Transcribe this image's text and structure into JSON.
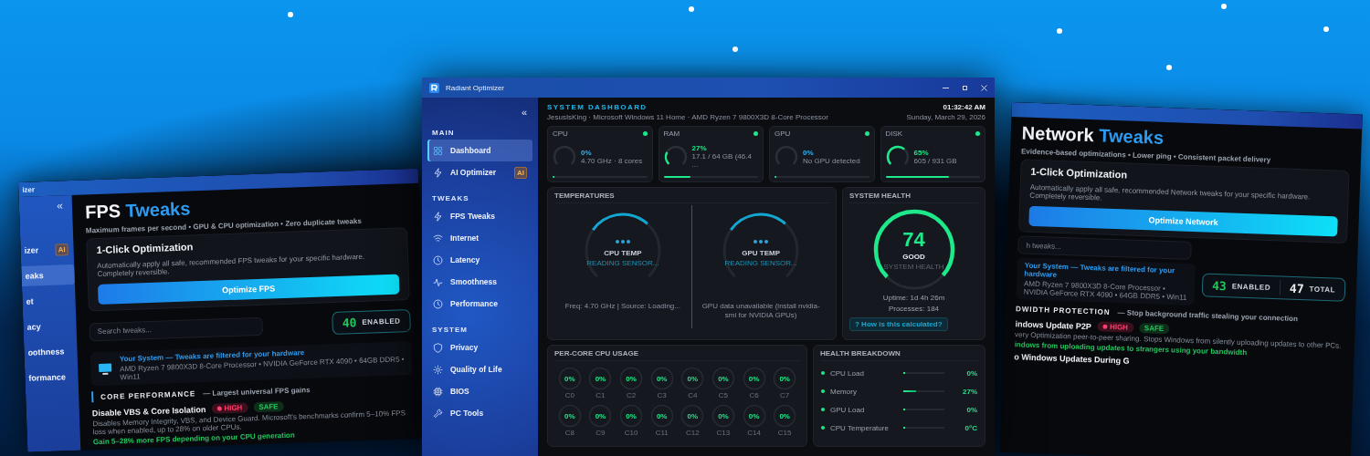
{
  "left_window": {
    "title": "izer",
    "sidebar": {
      "collapse": "«",
      "items": [
        {
          "label": "izer",
          "badge": "AI",
          "selected": false
        },
        {
          "label": "eaks",
          "selected": true
        },
        {
          "label": "et",
          "selected": false
        },
        {
          "label": "acy",
          "selected": false
        },
        {
          "label": "oothness",
          "selected": false
        },
        {
          "label": "formance",
          "selected": false
        }
      ]
    },
    "heading": {
      "first": "FPS",
      "second": "Tweaks"
    },
    "subtitle": "Maximum frames per second  •  GPU & CPU optimization  •  Zero duplicate tweaks",
    "optimize_card": {
      "title": "1-Click Optimization",
      "description": "Automatically apply all safe, recommended FPS tweaks for your specific hardware. Completely reversible.",
      "button": "Optimize FPS"
    },
    "counters": [
      {
        "value": "40",
        "label": "ENABLED"
      }
    ],
    "search": {
      "placeholder": "Search tweaks..."
    },
    "system_info": {
      "title": "Your System — Tweaks are filtered for your hardware",
      "specs": "AMD Ryzen 7 9800X3D 8-Core Processor  •  NVIDIA GeForce RTX 4090  •  64GB DDR5  •  Win11"
    },
    "section": {
      "title": "CORE PERFORMANCE",
      "subtitle": "— Largest universal FPS gains"
    },
    "tweaks": [
      {
        "title": "Disable VBS & Core Isolation",
        "badges": [
          {
            "label": "HIGH",
            "kind": "impact"
          },
          {
            "label": "SAFE",
            "kind": "safety"
          }
        ],
        "description": "Disables Memory Integrity, VBS, and Device Guard. Microsoft's benchmarks confirm 5–10% FPS loss when enabled, up to 28% on older CPUs.",
        "benefit": "Gain 5–28% more FPS depending on your CPU generation"
      }
    ]
  },
  "right_window": {
    "heading": {
      "first": "Network",
      "second": "Tweaks"
    },
    "subtitle": "Evidence-based optimizations  •  Lower ping  •  Consistent packet delivery",
    "optimize_card": {
      "title": "1-Click Optimization",
      "description": "Automatically apply all safe, recommended Network tweaks for your specific hardware. Completely reversible.",
      "button": "Optimize Network"
    },
    "search": {
      "placeholder": "h tweaks..."
    },
    "system_info": {
      "title": "Your System — Tweaks are filtered for your hardware",
      "specs": "AMD Ryzen 7 9800X3D 8-Core Processor  •  NVIDIA GeForce RTX 4090  •  64GB DDR5  •  Win11"
    },
    "counters": [
      {
        "value": "43",
        "label": "ENABLED"
      },
      {
        "value": "47",
        "label": "TOTAL"
      }
    ],
    "section": {
      "title": "DWIDTH PROTECTION",
      "subtitle": "— Stop background traffic stealing your connection"
    },
    "tweaks": [
      {
        "title": "indows Update P2P",
        "badges": [
          {
            "label": "HIGH",
            "kind": "impact"
          },
          {
            "label": "SAFE",
            "kind": "safety"
          }
        ],
        "description": "very Optimization peer-to-peer sharing. Stops Windows from silently uploading updates to other PCs.",
        "benefit": "indows from uploading updates to strangers using your bandwidth"
      },
      {
        "title": "o Windows Updates During G"
      }
    ]
  },
  "main_window": {
    "title": "Radiant Optimizer",
    "sidebar": {
      "collapse": "«",
      "sections": [
        {
          "title": "MAIN",
          "items": [
            {
              "label": "Dashboard",
              "selected": true
            },
            {
              "label": "AI Optimizer",
              "badge": "AI",
              "selected": false
            }
          ]
        },
        {
          "title": "TWEAKS",
          "items": [
            {
              "label": "FPS Tweaks",
              "selected": false
            },
            {
              "label": "Internet",
              "selected": false
            },
            {
              "label": "Latency",
              "selected": false
            },
            {
              "label": "Smoothness",
              "selected": false
            },
            {
              "label": "Performance",
              "selected": false
            }
          ]
        },
        {
          "title": "SYSTEM",
          "items": [
            {
              "label": "Privacy",
              "selected": false
            },
            {
              "label": "Quality of Life",
              "selected": false
            },
            {
              "label": "BIOS",
              "selected": false
            },
            {
              "label": "PC Tools",
              "selected": false
            }
          ]
        }
      ]
    },
    "header": {
      "title": "SYSTEM DASHBOARD",
      "subtitle": "JesusIsKing  ·  Microsoft Windows 11 Home  ·  AMD Ryzen 7 9800X3D 8-Core Processor",
      "time": "01:32:42 AM",
      "date": "Sunday, March 29, 2026"
    },
    "stat_cards": [
      {
        "label": "CPU",
        "value": "0%",
        "detail": "4.70 GHz  ·  8 cores",
        "level": 0
      },
      {
        "label": "RAM",
        "value": "27%",
        "detail": "17.1 / 64 GB  (46.4 ...",
        "level": 0.27
      },
      {
        "label": "GPU",
        "value": "0%",
        "detail": "No GPU detected",
        "level": 0
      },
      {
        "label": "DISK",
        "value": "65%",
        "detail": "605 / 931 GB",
        "level": 0.65
      }
    ],
    "temperatures": {
      "title": "TEMPERATURES",
      "gauges": [
        {
          "label": "CPU TEMP",
          "status": "READING SENSOR...",
          "footer": "Freq: 4.70 GHz  |  Source: Loading..."
        },
        {
          "label": "GPU TEMP",
          "status": "READING SENSOR...",
          "footer": "GPU data unavailable (install nvidia-smi for NVIDIA GPUs)"
        }
      ]
    },
    "system_health": {
      "title": "SYSTEM HEALTH",
      "score": "74",
      "rating": "GOOD",
      "caption": "SYSTEM HEALTH",
      "level": 0.74,
      "uptime": "Uptime: 1d 4h 26m",
      "processes": "Processes: 184",
      "help_button": "?  How is this calculated?"
    },
    "per_core": {
      "title": "PER-CORE CPU USAGE",
      "cores": [
        {
          "value": "0%",
          "label": "C0",
          "level": 0
        },
        {
          "value": "0%",
          "label": "C1",
          "level": 0
        },
        {
          "value": "0%",
          "label": "C2",
          "level": 0
        },
        {
          "value": "0%",
          "label": "C3",
          "level": 0
        },
        {
          "value": "0%",
          "label": "C4",
          "level": 0
        },
        {
          "value": "0%",
          "label": "C5",
          "level": 0
        },
        {
          "value": "0%",
          "label": "C6",
          "level": 0
        },
        {
          "value": "0%",
          "label": "C7",
          "level": 0
        },
        {
          "value": "0%",
          "label": "C8",
          "level": 0
        },
        {
          "value": "0%",
          "label": "C9",
          "level": 0
        },
        {
          "value": "0%",
          "label": "C10",
          "level": 0
        },
        {
          "value": "0%",
          "label": "C11",
          "level": 0
        },
        {
          "value": "0%",
          "label": "C12",
          "level": 0
        },
        {
          "value": "0%",
          "label": "C13",
          "level": 0
        },
        {
          "value": "0%",
          "label": "C14",
          "level": 0
        },
        {
          "value": "0%",
          "label": "C15",
          "level": 0
        }
      ]
    },
    "health_breakdown": {
      "title": "HEALTH BREAKDOWN",
      "rows": [
        {
          "label": "CPU Load",
          "value": "0%",
          "level": 0
        },
        {
          "label": "Memory",
          "value": "27%",
          "level": 0.27
        },
        {
          "label": "GPU Load",
          "value": "0%",
          "level": 0
        },
        {
          "label": "CPU Temperature",
          "value": "0°C",
          "level": 0
        }
      ]
    }
  }
}
